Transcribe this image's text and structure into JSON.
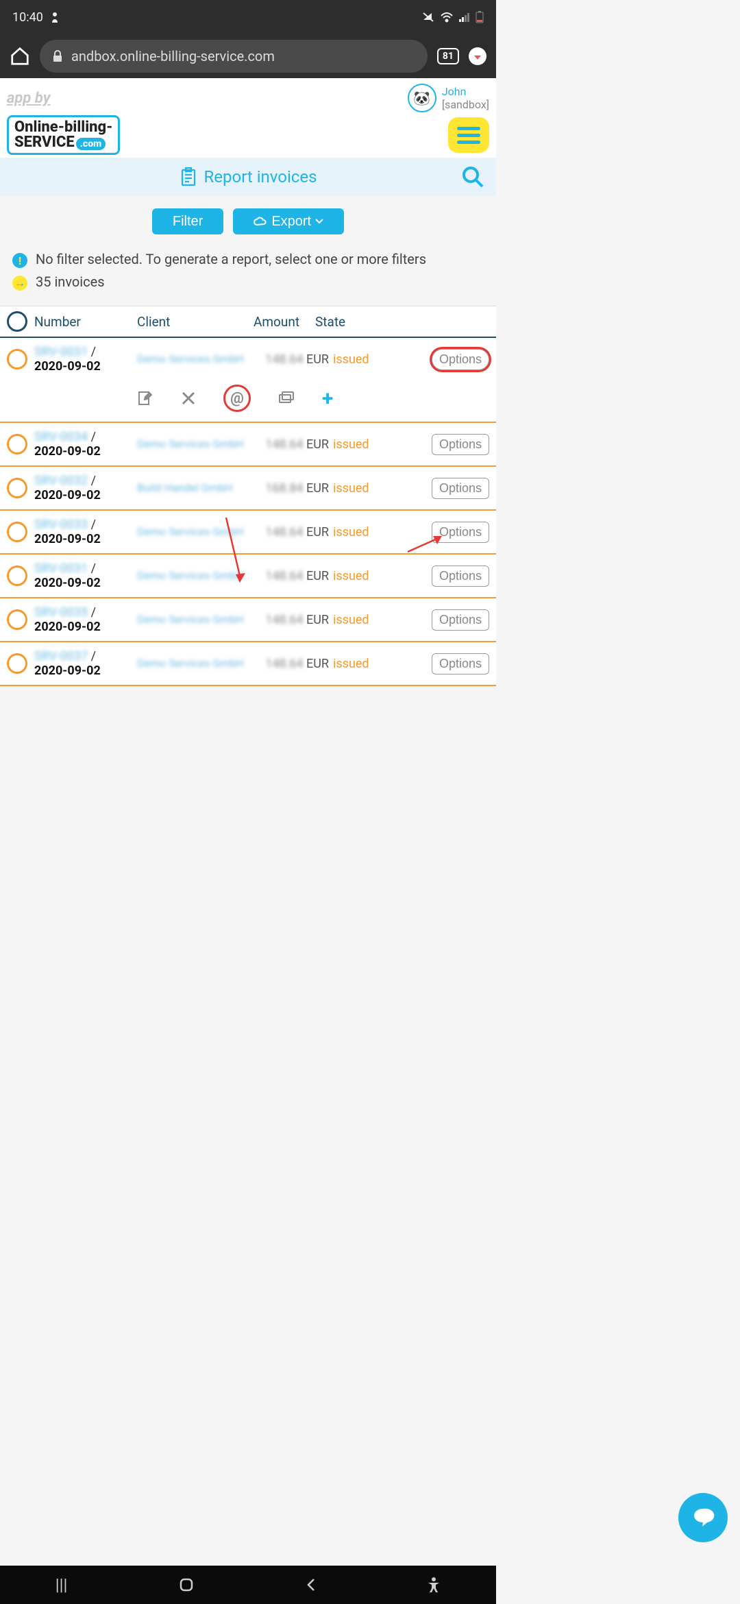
{
  "status_bar": {
    "time": "10:40",
    "tab_count": "81"
  },
  "address_bar": {
    "url": "andbox.online-billing-service.com"
  },
  "app_header": {
    "app_by": "app by",
    "logo_line1": "Online-billing-",
    "logo_line2": "SERVICE",
    "logo_tld": ".com",
    "user_name": "John",
    "user_env": "[sandbox]"
  },
  "page_title": "Report invoices",
  "buttons": {
    "filter": "Filter",
    "export": "Export"
  },
  "info": {
    "no_filter": "No filter selected. To generate a report, select one or more filters",
    "count": "35 invoices"
  },
  "columns": {
    "number": "Number",
    "client": "Client",
    "amount": "Amount",
    "state": "State"
  },
  "rows": [
    {
      "num_blur": "SRV-0031",
      "sep": " /",
      "date": "2020-09-02",
      "client": "Demo Services GmbH",
      "amt_blur": "148.64",
      "currency": "EUR",
      "state": "issued",
      "options": "Options",
      "expanded": true,
      "highlight": true
    },
    {
      "num_blur": "SRV-0034",
      "sep": " /",
      "date": "2020-09-02",
      "client": "Demo Services GmbH",
      "amt_blur": "148.64",
      "currency": "EUR",
      "state": "issued",
      "options": "Options"
    },
    {
      "num_blur": "SRV-0032",
      "sep": " /",
      "date": "2020-09-02",
      "client": "Build Handel GmbH",
      "amt_blur": "168.84",
      "currency": "EUR",
      "state": "issued",
      "options": "Options"
    },
    {
      "num_blur": "SRV-0033",
      "sep": " /",
      "date": "2020-09-02",
      "client": "Demo Services GmbH",
      "amt_blur": "148.64",
      "currency": "EUR",
      "state": "issued",
      "options": "Options"
    },
    {
      "num_blur": "SRV-0031",
      "sep": " /",
      "date": "2020-09-02",
      "client": "Demo Services GmbH",
      "amt_blur": "148.64",
      "currency": "EUR",
      "state": "issued",
      "options": "Options"
    },
    {
      "num_blur": "SRV-0035",
      "sep": " /",
      "date": "2020-09-02",
      "client": "Demo Services GmbH",
      "amt_blur": "148.64",
      "currency": "EUR",
      "state": "issued",
      "options": "Options"
    },
    {
      "num_blur": "SRV-0037",
      "sep": " /",
      "date": "2020-09-02",
      "client": "Demo Services GmbH",
      "amt_blur": "148.64",
      "currency": "EUR",
      "state": "issued",
      "options": "Options"
    }
  ]
}
